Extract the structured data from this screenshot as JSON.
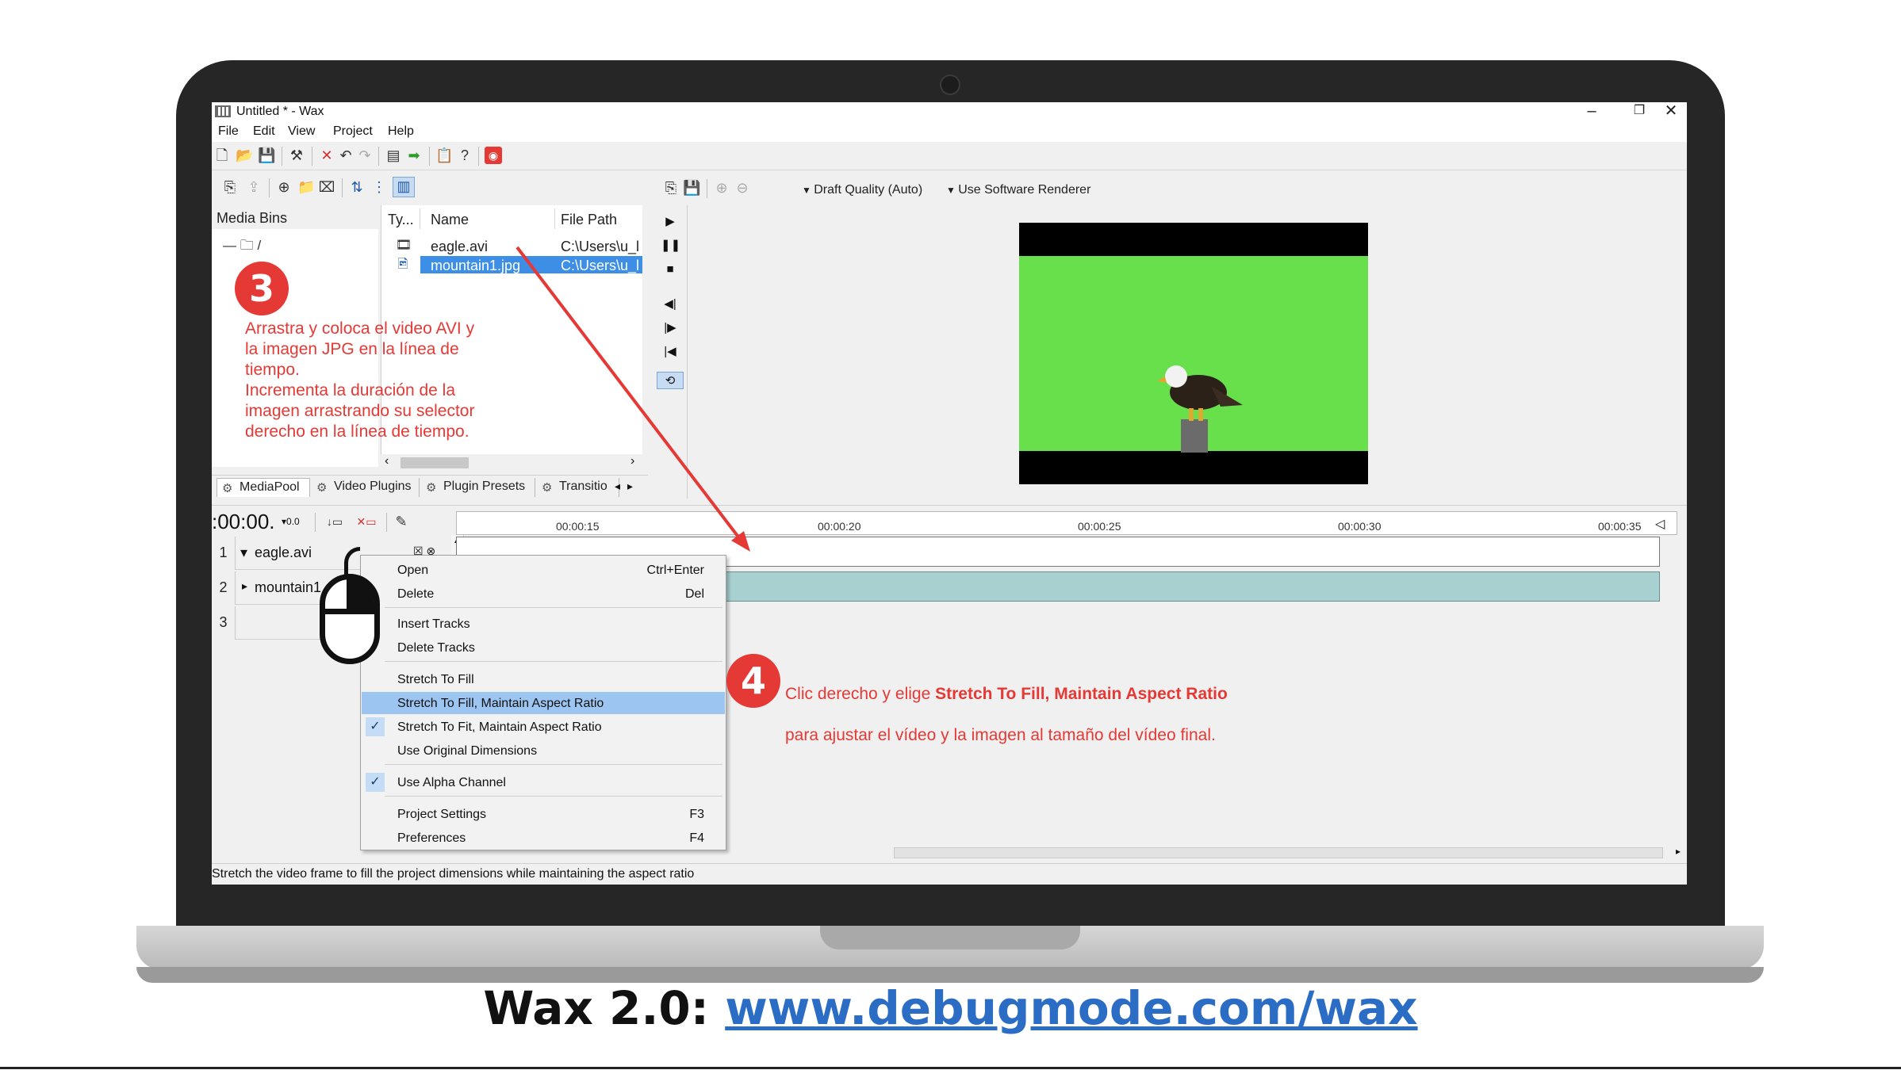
{
  "window": {
    "title": "Untitled * - Wax",
    "minimize": "–",
    "maximize": "❐",
    "close": "✕"
  },
  "menu": [
    "File",
    "Edit",
    "View",
    "Project",
    "Help"
  ],
  "media_bins": {
    "header": "Media Bins",
    "root": "/"
  },
  "file_list": {
    "columns": [
      "Ty...",
      "Name",
      "File Path"
    ],
    "rows": [
      {
        "name": "eagle.avi",
        "path": "C:\\Users\\u_l",
        "icon": "film-icon",
        "selected": false
      },
      {
        "name": "mountain1.jpg",
        "path": "C:\\Users\\u_l",
        "icon": "image-icon",
        "selected": true
      }
    ]
  },
  "panel_tabs": [
    "MediaPool",
    "Video Plugins",
    "Plugin Presets",
    "Transitio"
  ],
  "preview": {
    "quality": "Draft Quality (Auto)",
    "renderer": "Use Software Renderer",
    "bg_color": "#67e04b"
  },
  "timeline": {
    "time": ":00:00.",
    "zoom_label": "0.0",
    "ruler_labels": [
      "00:00:15",
      "00:00:20",
      "00:00:25",
      "00:00:30",
      "00:00:35"
    ],
    "tracks": [
      {
        "num": "1",
        "name": "eagle.avi",
        "expanded": true
      },
      {
        "num": "2",
        "name": "mountain1",
        "expanded": false
      },
      {
        "num": "3",
        "name": "",
        "expanded": false
      }
    ]
  },
  "context_menu": {
    "items": [
      {
        "label": "Open",
        "shortcut": "Ctrl+Enter"
      },
      {
        "label": "Delete",
        "shortcut": "Del"
      },
      {
        "label": "Insert Tracks",
        "shortcut": ""
      },
      {
        "label": "Delete Tracks",
        "shortcut": ""
      },
      {
        "label": "Stretch To Fill",
        "shortcut": ""
      },
      {
        "label": "Stretch To Fill, Maintain Aspect Ratio",
        "shortcut": "",
        "highlighted": true
      },
      {
        "label": "Stretch To Fit, Maintain Aspect Ratio",
        "shortcut": "",
        "checked": true
      },
      {
        "label": "Use Original Dimensions",
        "shortcut": ""
      },
      {
        "label": "Use Alpha Channel",
        "shortcut": "",
        "checked": true
      },
      {
        "label": "Project Settings",
        "shortcut": "F3"
      },
      {
        "label": "Preferences",
        "shortcut": "F4"
      }
    ],
    "check_glyph": "✓"
  },
  "status_bar": "Stretch the video frame to fill the project dimensions while maintaining the aspect ratio",
  "annotations": {
    "step3": {
      "badge": "3",
      "text": "Arrastra y coloca el video AVI y\nla imagen JPG en la línea de\ntiempo.\nIncrementa la duración de la\nimagen arrastrando su selector\nderecho en la línea de tiempo."
    },
    "step4": {
      "badge": "4",
      "text_prefix": "Clic derecho y elige ",
      "text_bold": "Stretch To Fill, Maintain Aspect Ratio",
      "text_line2": "para ajustar el vídeo y la imagen al tamaño del vídeo final."
    },
    "color": "#e53935"
  },
  "footer": {
    "prefix": "Wax 2.0: ",
    "link": "www.debugmode.com/wax"
  }
}
